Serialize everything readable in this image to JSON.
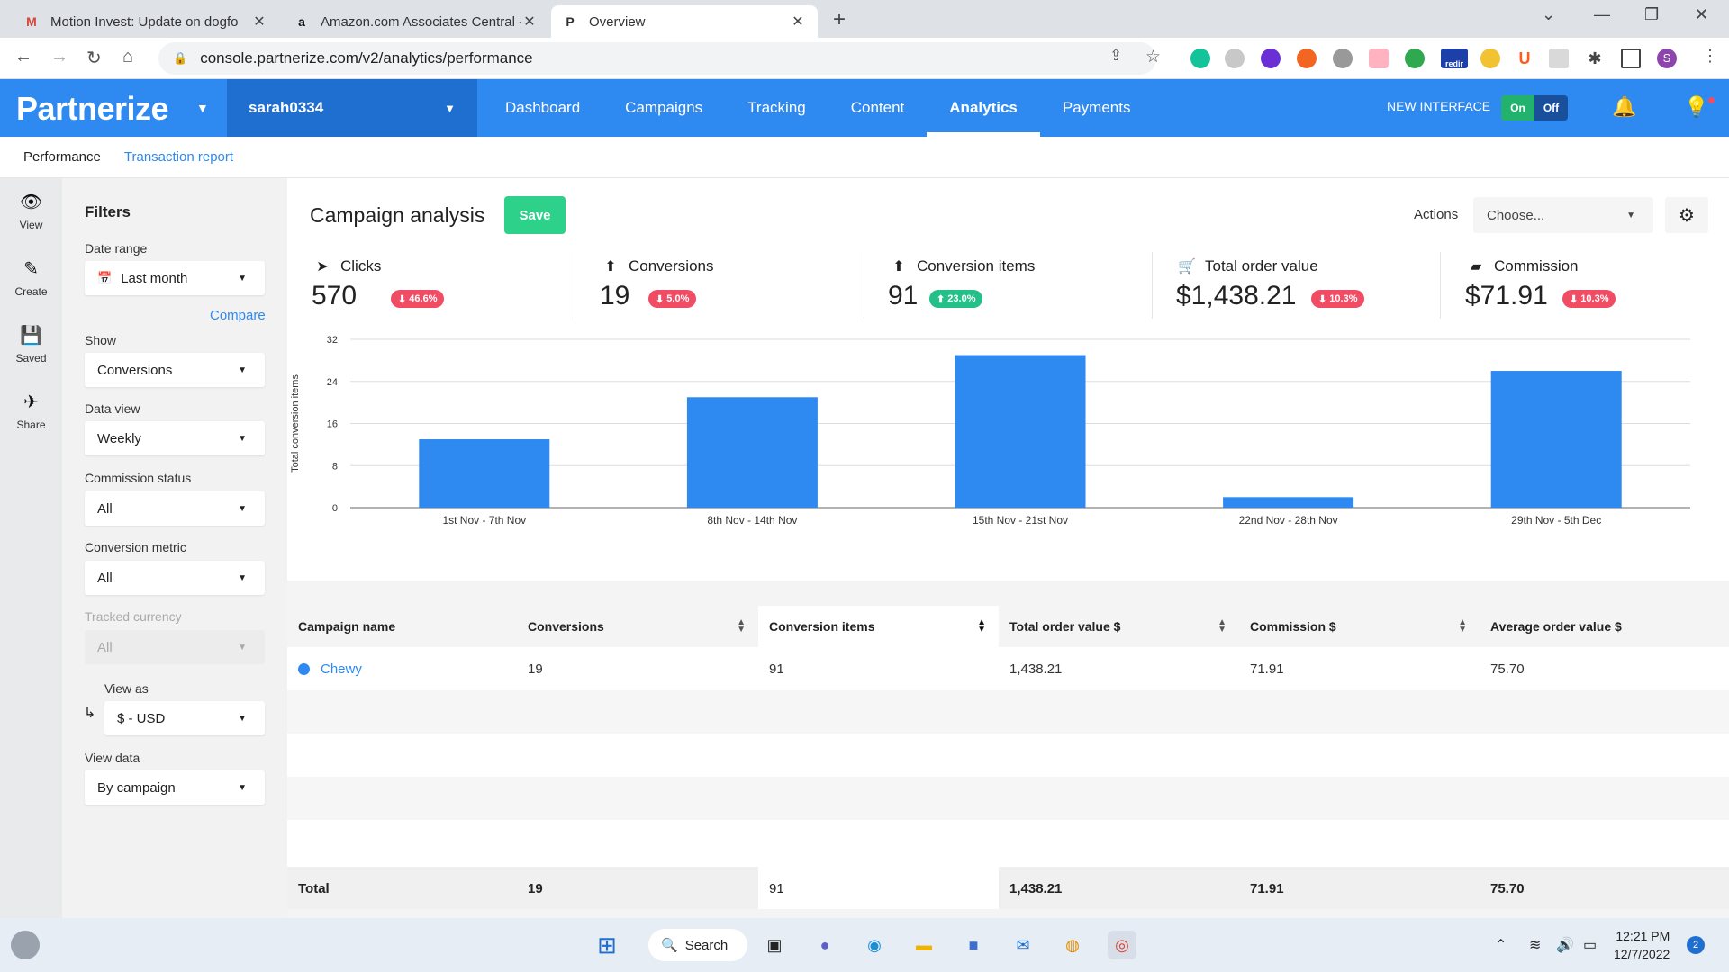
{
  "browser": {
    "tabs": [
      {
        "title": "Motion Invest: Update on dogfo",
        "icon": "gmail-icon"
      },
      {
        "title": "Amazon.com Associates Central -",
        "icon": "amazon-icon"
      },
      {
        "title": "Overview",
        "icon": "partnerize-icon"
      }
    ],
    "url": "console.partnerize.com/v2/analytics/performance",
    "extension_badge": "redir",
    "profile_initial": "S"
  },
  "app": {
    "logo": "Partnerize",
    "account": "sarah0334",
    "nav": [
      "Dashboard",
      "Campaigns",
      "Tracking",
      "Content",
      "Analytics",
      "Payments"
    ],
    "active_nav": "Analytics",
    "new_interface_label": "NEW INTERFACE",
    "toggle_on": "On",
    "toggle_off": "Off",
    "accent_color": "#2e89f0"
  },
  "subnav": {
    "performance": "Performance",
    "transaction_report": "Transaction report"
  },
  "rail": [
    "View",
    "Create",
    "Saved",
    "Share"
  ],
  "filters": {
    "title": "Filters",
    "date_range_label": "Date range",
    "date_range_value": "Last month",
    "compare": "Compare",
    "show_label": "Show",
    "show_value": "Conversions",
    "data_view_label": "Data view",
    "data_view_value": "Weekly",
    "commission_status_label": "Commission status",
    "commission_status_value": "All",
    "conversion_metric_label": "Conversion metric",
    "conversion_metric_value": "All",
    "tracked_currency_label": "Tracked currency",
    "tracked_currency_value": "All",
    "view_as_label": "View as",
    "view_as_value": "$ - USD",
    "view_data_label": "View data",
    "view_data_value": "By campaign"
  },
  "campaign": {
    "title": "Campaign analysis",
    "save": "Save",
    "actions_label": "Actions",
    "actions_placeholder": "Choose..."
  },
  "kpis": [
    {
      "label": "Clicks",
      "value": "570",
      "change": "46.6%",
      "direction": "down",
      "icon": "cursor-icon"
    },
    {
      "label": "Conversions",
      "value": "19",
      "change": "5.0%",
      "direction": "down",
      "icon": "arrow-circle-icon"
    },
    {
      "label": "Conversion items",
      "value": "91",
      "change": "23.0%",
      "direction": "up",
      "icon": "arrow-circle-icon"
    },
    {
      "label": "Total order value",
      "value": "$1,438.21",
      "change": "10.3%",
      "direction": "down",
      "icon": "cart-icon"
    },
    {
      "label": "Commission",
      "value": "$71.91",
      "change": "10.3%",
      "direction": "down",
      "icon": "wallet-icon"
    }
  ],
  "chart_data": {
    "type": "bar",
    "categories": [
      "1st Nov - 7th Nov",
      "8th Nov - 14th Nov",
      "15th Nov - 21st Nov",
      "22nd Nov - 28th Nov",
      "29th Nov - 5th Dec"
    ],
    "values": [
      13,
      21,
      29,
      2,
      26
    ],
    "ylabel": "Total conversion items",
    "ylim": [
      0,
      32
    ],
    "yticks": [
      0,
      8,
      16,
      24,
      32
    ],
    "grid": true,
    "color": "#2e89f0"
  },
  "table": {
    "columns": [
      "Campaign name",
      "Conversions",
      "Conversion items",
      "Total order value $",
      "Commission $",
      "Average order value $"
    ],
    "rows": [
      {
        "name": "Chewy",
        "conversions": "19",
        "items": "91",
        "order_value": "1,438.21",
        "commission": "71.91",
        "avg": "75.70"
      }
    ],
    "total": {
      "label": "Total",
      "conversions": "19",
      "items": "91",
      "order_value": "1,438.21",
      "commission": "71.91",
      "avg": "75.70"
    }
  },
  "taskbar": {
    "search": "Search",
    "time": "12:21 PM",
    "date": "12/7/2022",
    "notifications": "2"
  }
}
